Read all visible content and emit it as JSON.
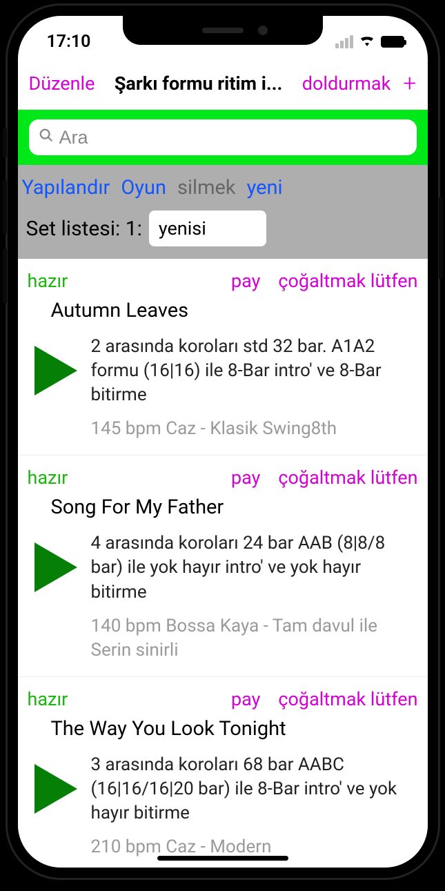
{
  "status_bar": {
    "time": "17:10"
  },
  "nav": {
    "edit": "Düzenle",
    "title": "Şarkı formu ritim i...",
    "fill": "doldurmak"
  },
  "search": {
    "placeholder": "Ara"
  },
  "config": {
    "configure": "Yapılandır",
    "play": "Oyun",
    "delete": "silmek",
    "new": "yeni",
    "setlist_label": "Set listesi: 1:",
    "setlist_name": "yenisi"
  },
  "actions": {
    "ready": "hazır",
    "share": "pay",
    "duplicate": "çoğaltmak lütfen"
  },
  "songs": [
    {
      "title": "Autumn Leaves",
      "desc": "2 arasında koroları std 32 bar. A1A2 formu (16|16) ile 8-Bar intro' ve 8-Bar bitirme",
      "meta": "145 bpm Caz - Klasik Swing8th"
    },
    {
      "title": "Song For My Father",
      "desc": "4 arasında koroları 24 bar AAB (8|8/8 bar) ile yok hayır intro' ve yok hayır bitirme",
      "meta": "140 bpm Bossa Kaya - Tam davul ile Serin sinirli"
    },
    {
      "title": "The Way You Look Tonight",
      "desc": "3 arasında koroları 68 bar AABC (16|16/16|20 bar) ile 8-Bar intro' ve yok hayır bitirme",
      "meta": "210 bpm Caz - Modern"
    }
  ]
}
